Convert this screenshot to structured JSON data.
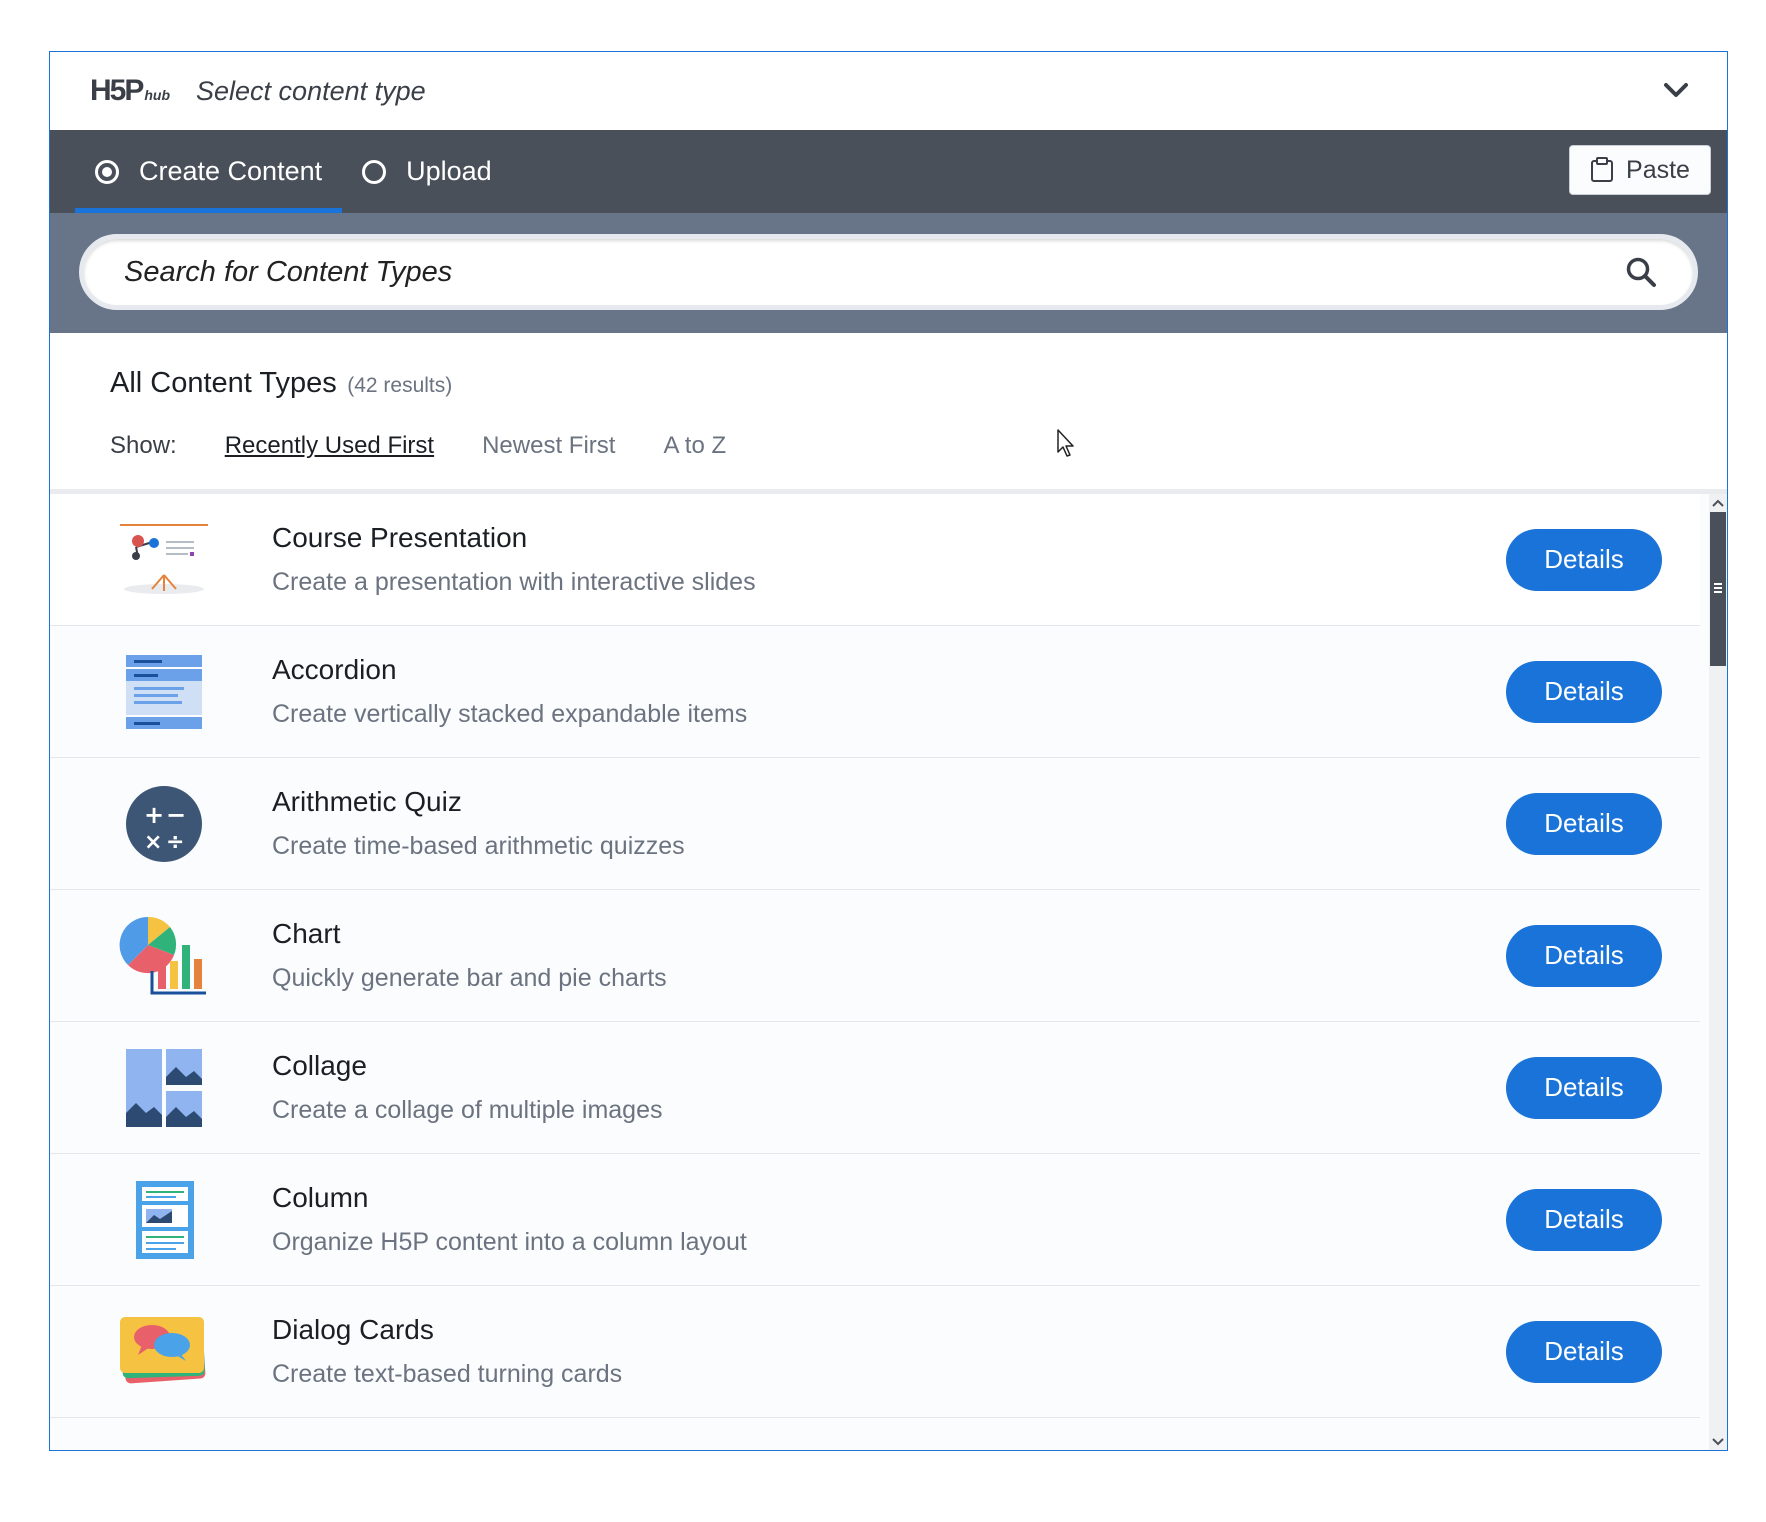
{
  "header": {
    "logo_big": "H5P",
    "logo_small": "hub",
    "title": "Select content type"
  },
  "tabs": [
    {
      "label": "Create Content",
      "selected": true
    },
    {
      "label": "Upload",
      "selected": false
    }
  ],
  "paste_label": "Paste",
  "search": {
    "placeholder": "Search for Content Types"
  },
  "listing": {
    "title": "All Content Types",
    "count": "(42 results)",
    "show_label": "Show:",
    "sort_options": [
      "Recently Used First",
      "Newest First",
      "A to Z"
    ],
    "selected_sort": "Recently Used First"
  },
  "details_label": "Details",
  "items": [
    {
      "title": "Course Presentation",
      "desc": "Create a presentation with interactive slides",
      "icon": "course-presentation-icon"
    },
    {
      "title": "Accordion",
      "desc": "Create vertically stacked expandable items",
      "icon": "accordion-icon"
    },
    {
      "title": "Arithmetic Quiz",
      "desc": "Create time-based arithmetic quizzes",
      "icon": "arithmetic-quiz-icon"
    },
    {
      "title": "Chart",
      "desc": "Quickly generate bar and pie charts",
      "icon": "chart-icon"
    },
    {
      "title": "Collage",
      "desc": "Create a collage of multiple images",
      "icon": "collage-icon"
    },
    {
      "title": "Column",
      "desc": "Organize H5P content into a column layout",
      "icon": "column-icon"
    },
    {
      "title": "Dialog Cards",
      "desc": "Create text-based turning cards",
      "icon": "dialog-cards-icon"
    }
  ],
  "colors": {
    "accent": "#1a73d9",
    "tabbar": "#4a505a",
    "searchband": "#687588"
  }
}
